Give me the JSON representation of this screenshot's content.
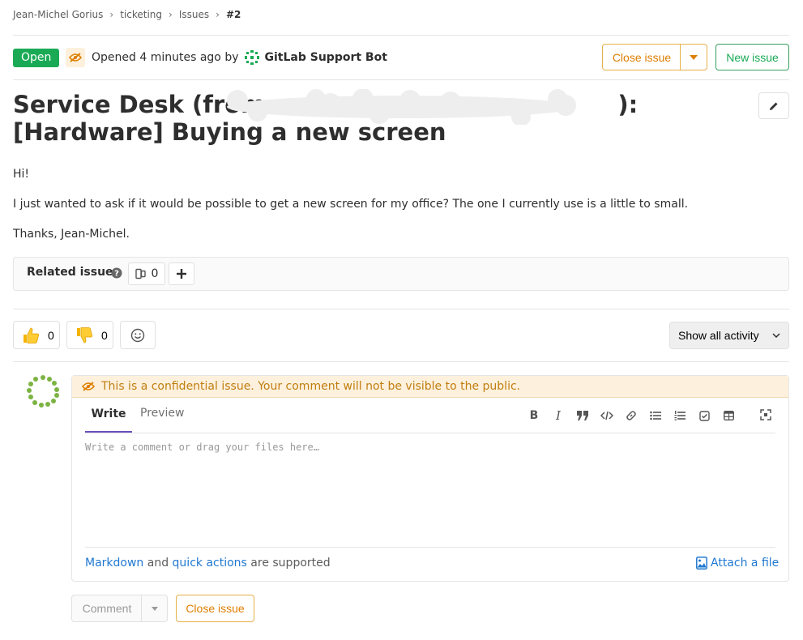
{
  "breadcrumb": {
    "items": [
      "Jean-Michel Gorius",
      "ticketing",
      "Issues"
    ],
    "current": "#2",
    "separator": "›"
  },
  "header": {
    "status": "Open",
    "opened_prefix": "Opened",
    "opened_time": "4 minutes ago",
    "opened_by": "by",
    "author": "GitLab Support Bot",
    "close_issue_label": "Close issue",
    "new_issue_label": "New issue"
  },
  "issue": {
    "title_part1": "Service Desk (from",
    "title_part2": "): [Hardware] Buying a new screen",
    "description": [
      "Hi!",
      "I just wanted to ask if it would be possible to get a new screen for my office? The one I currently use is a little to small.",
      "Thanks, Jean-Michel."
    ]
  },
  "related": {
    "title": "Related issues",
    "count": "0"
  },
  "awards": {
    "thumbs_up": "0",
    "thumbs_down": "0",
    "activity_filter": "Show all activity"
  },
  "comment": {
    "confidential_warning": "This is a confidential issue. Your comment will not be visible to the public.",
    "tab_write": "Write",
    "tab_preview": "Preview",
    "placeholder": "Write a comment or drag your files here…",
    "markdown_link": "Markdown",
    "and_text": "and",
    "quick_actions_link": "quick actions",
    "supported_text": "are supported",
    "attach_label": "Attach a file",
    "comment_button": "Comment",
    "close_issue_button": "Close issue"
  },
  "colors": {
    "open_badge": "#1aaa55",
    "warning_text": "#c17d10",
    "warning_bg": "#fdf1dd",
    "link": "#1f78d1",
    "active_tab": "#6b4fbb"
  }
}
